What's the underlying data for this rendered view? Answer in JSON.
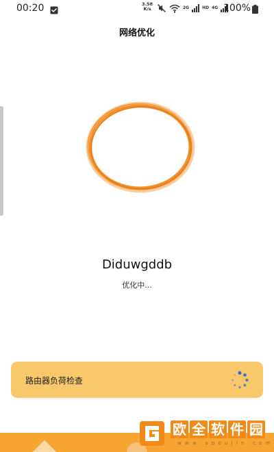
{
  "status_bar": {
    "time": "00:20",
    "net_speed_value": "3.58",
    "net_speed_unit": "K/s",
    "net_tag_1": "2G",
    "net_tag_2": "HD",
    "net_tag_3": "4G",
    "battery": "100%",
    "icons": [
      "message-icon",
      "mute-icon",
      "wifi-icon",
      "signal-icon",
      "signal-icon",
      "battery-icon"
    ]
  },
  "header": {
    "title": "网络优化"
  },
  "main": {
    "device_name": "Diduwgddb",
    "status": "优化中..."
  },
  "check_card": {
    "label": "路由器负荷检查",
    "icon": "loading-spinner-icon"
  },
  "watermark": {
    "chars": [
      "欧",
      "全",
      "软",
      "件",
      "园"
    ],
    "url": "w w w . a p o u j i n . c o m"
  },
  "colors": {
    "ring": "#f0902a",
    "card": "#f9c86a",
    "bottom": "#f6a531",
    "spinner": "#2f6fd0"
  }
}
